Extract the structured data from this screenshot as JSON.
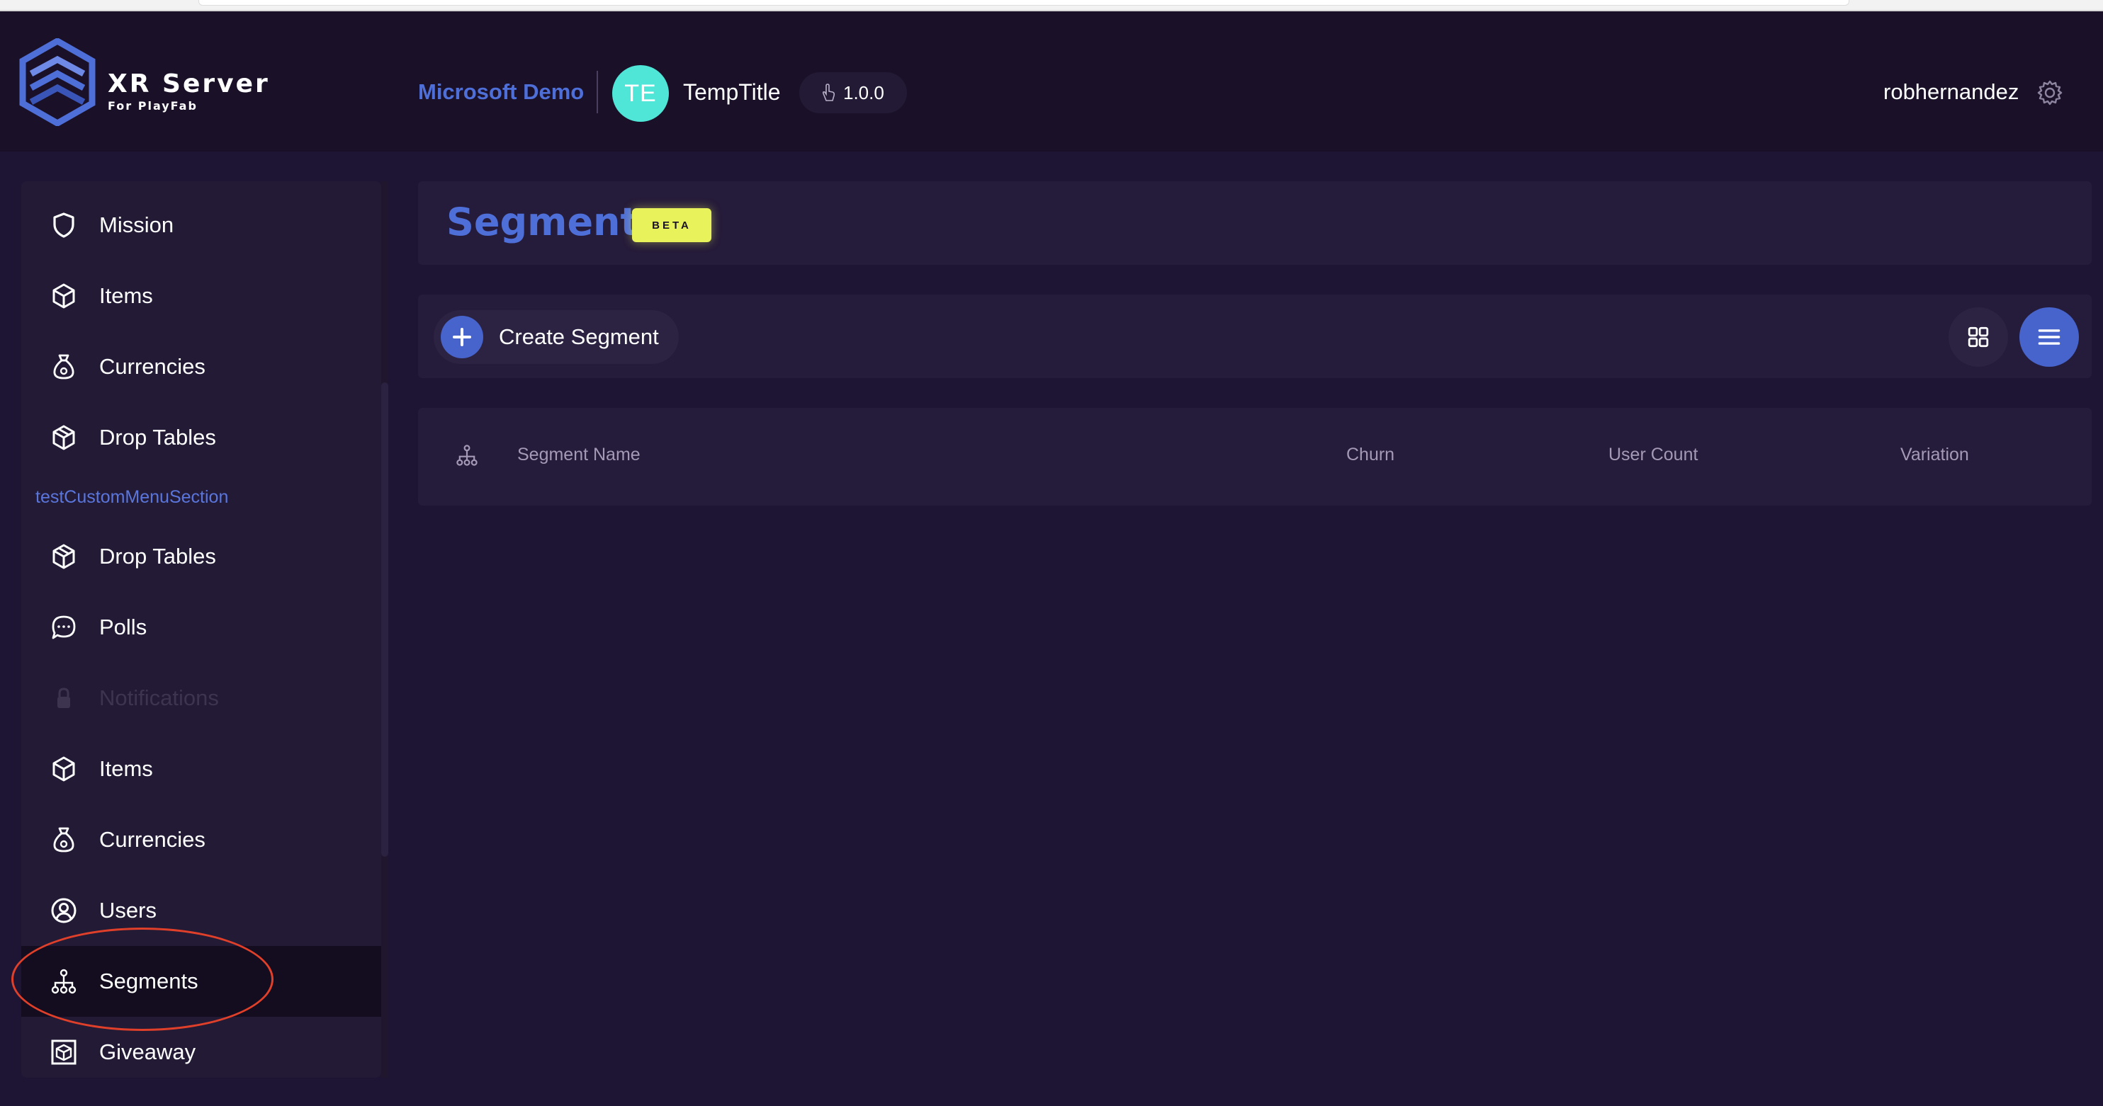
{
  "app": {
    "brand_name": "XR Server",
    "brand_sub": "For PlayFab",
    "logo_icon": "xr-server-hexagon-logo",
    "accent_color": "#4f6fd8"
  },
  "header": {
    "org_name": "Microsoft Demo",
    "title_initials": "TE",
    "title_avatar_color": "#4fe6d8",
    "title_name": "TempTitle",
    "version": "1.0.0",
    "version_icon": "hand-pointer-icon",
    "username": "robhernandez",
    "settings_icon": "gear-icon"
  },
  "sidebar": {
    "items": [
      {
        "label": "Mission",
        "icon": "shield-icon"
      },
      {
        "label": "Items",
        "icon": "cube-icon"
      },
      {
        "label": "Currencies",
        "icon": "money-bag-icon"
      },
      {
        "label": "Drop Tables",
        "icon": "box-icon"
      },
      {
        "label": "Drop Tables",
        "icon": "box-icon"
      },
      {
        "label": "Polls",
        "icon": "chat-bubble-icon"
      },
      {
        "label": "Notifications",
        "icon": "lock-icon",
        "disabled": true
      },
      {
        "label": "Items",
        "icon": "cube-icon"
      },
      {
        "label": "Currencies",
        "icon": "money-bag-icon"
      },
      {
        "label": "Users",
        "icon": "user-circle-icon"
      },
      {
        "label": "Segments",
        "icon": "hierarchy-icon",
        "active": true
      },
      {
        "label": "Giveaway",
        "icon": "gift-box-icon"
      }
    ],
    "section_label": "testCustomMenuSection"
  },
  "page": {
    "title": "Segments",
    "badge": "BETA",
    "badge_color": "#e8f25a"
  },
  "toolbar": {
    "create_label": "Create Segment",
    "create_icon": "plus-icon",
    "grid_view_icon": "grid-icon",
    "list_view_icon": "list-icon"
  },
  "table": {
    "header_icon": "hierarchy-icon",
    "columns": [
      "Segment Name",
      "Churn",
      "User Count",
      "Variation"
    ]
  },
  "annotation": {
    "color": "#e0402a"
  }
}
